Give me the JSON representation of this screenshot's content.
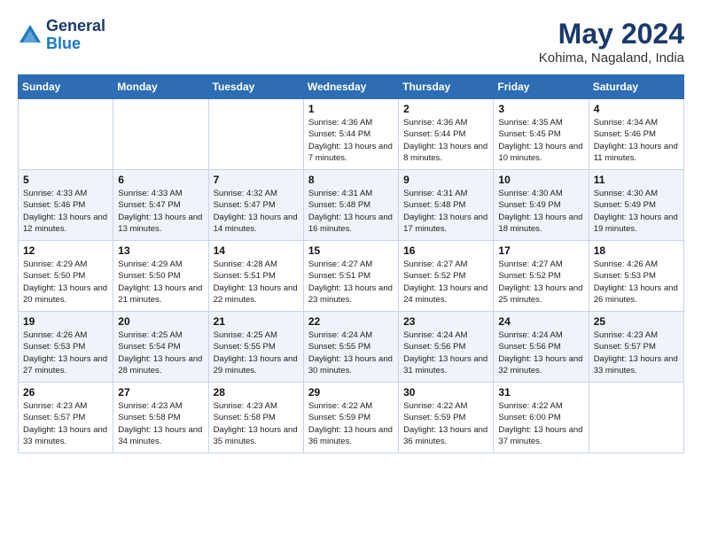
{
  "header": {
    "logo_line1": "General",
    "logo_line2": "Blue",
    "month_year": "May 2024",
    "location": "Kohima, Nagaland, India"
  },
  "weekdays": [
    "Sunday",
    "Monday",
    "Tuesday",
    "Wednesday",
    "Thursday",
    "Friday",
    "Saturday"
  ],
  "weeks": [
    [
      {
        "day": "",
        "info": ""
      },
      {
        "day": "",
        "info": ""
      },
      {
        "day": "",
        "info": ""
      },
      {
        "day": "1",
        "info": "Sunrise: 4:36 AM\nSunset: 5:44 PM\nDaylight: 13 hours\nand 7 minutes."
      },
      {
        "day": "2",
        "info": "Sunrise: 4:36 AM\nSunset: 5:44 PM\nDaylight: 13 hours\nand 8 minutes."
      },
      {
        "day": "3",
        "info": "Sunrise: 4:35 AM\nSunset: 5:45 PM\nDaylight: 13 hours\nand 10 minutes."
      },
      {
        "day": "4",
        "info": "Sunrise: 4:34 AM\nSunset: 5:46 PM\nDaylight: 13 hours\nand 11 minutes."
      }
    ],
    [
      {
        "day": "5",
        "info": "Sunrise: 4:33 AM\nSunset: 5:46 PM\nDaylight: 13 hours\nand 12 minutes."
      },
      {
        "day": "6",
        "info": "Sunrise: 4:33 AM\nSunset: 5:47 PM\nDaylight: 13 hours\nand 13 minutes."
      },
      {
        "day": "7",
        "info": "Sunrise: 4:32 AM\nSunset: 5:47 PM\nDaylight: 13 hours\nand 14 minutes."
      },
      {
        "day": "8",
        "info": "Sunrise: 4:31 AM\nSunset: 5:48 PM\nDaylight: 13 hours\nand 16 minutes."
      },
      {
        "day": "9",
        "info": "Sunrise: 4:31 AM\nSunset: 5:48 PM\nDaylight: 13 hours\nand 17 minutes."
      },
      {
        "day": "10",
        "info": "Sunrise: 4:30 AM\nSunset: 5:49 PM\nDaylight: 13 hours\nand 18 minutes."
      },
      {
        "day": "11",
        "info": "Sunrise: 4:30 AM\nSunset: 5:49 PM\nDaylight: 13 hours\nand 19 minutes."
      }
    ],
    [
      {
        "day": "12",
        "info": "Sunrise: 4:29 AM\nSunset: 5:50 PM\nDaylight: 13 hours\nand 20 minutes."
      },
      {
        "day": "13",
        "info": "Sunrise: 4:29 AM\nSunset: 5:50 PM\nDaylight: 13 hours\nand 21 minutes."
      },
      {
        "day": "14",
        "info": "Sunrise: 4:28 AM\nSunset: 5:51 PM\nDaylight: 13 hours\nand 22 minutes."
      },
      {
        "day": "15",
        "info": "Sunrise: 4:27 AM\nSunset: 5:51 PM\nDaylight: 13 hours\nand 23 minutes."
      },
      {
        "day": "16",
        "info": "Sunrise: 4:27 AM\nSunset: 5:52 PM\nDaylight: 13 hours\nand 24 minutes."
      },
      {
        "day": "17",
        "info": "Sunrise: 4:27 AM\nSunset: 5:52 PM\nDaylight: 13 hours\nand 25 minutes."
      },
      {
        "day": "18",
        "info": "Sunrise: 4:26 AM\nSunset: 5:53 PM\nDaylight: 13 hours\nand 26 minutes."
      }
    ],
    [
      {
        "day": "19",
        "info": "Sunrise: 4:26 AM\nSunset: 5:53 PM\nDaylight: 13 hours\nand 27 minutes."
      },
      {
        "day": "20",
        "info": "Sunrise: 4:25 AM\nSunset: 5:54 PM\nDaylight: 13 hours\nand 28 minutes."
      },
      {
        "day": "21",
        "info": "Sunrise: 4:25 AM\nSunset: 5:55 PM\nDaylight: 13 hours\nand 29 minutes."
      },
      {
        "day": "22",
        "info": "Sunrise: 4:24 AM\nSunset: 5:55 PM\nDaylight: 13 hours\nand 30 minutes."
      },
      {
        "day": "23",
        "info": "Sunrise: 4:24 AM\nSunset: 5:56 PM\nDaylight: 13 hours\nand 31 minutes."
      },
      {
        "day": "24",
        "info": "Sunrise: 4:24 AM\nSunset: 5:56 PM\nDaylight: 13 hours\nand 32 minutes."
      },
      {
        "day": "25",
        "info": "Sunrise: 4:23 AM\nSunset: 5:57 PM\nDaylight: 13 hours\nand 33 minutes."
      }
    ],
    [
      {
        "day": "26",
        "info": "Sunrise: 4:23 AM\nSunset: 5:57 PM\nDaylight: 13 hours\nand 33 minutes."
      },
      {
        "day": "27",
        "info": "Sunrise: 4:23 AM\nSunset: 5:58 PM\nDaylight: 13 hours\nand 34 minutes."
      },
      {
        "day": "28",
        "info": "Sunrise: 4:23 AM\nSunset: 5:58 PM\nDaylight: 13 hours\nand 35 minutes."
      },
      {
        "day": "29",
        "info": "Sunrise: 4:22 AM\nSunset: 5:59 PM\nDaylight: 13 hours\nand 36 minutes."
      },
      {
        "day": "30",
        "info": "Sunrise: 4:22 AM\nSunset: 5:59 PM\nDaylight: 13 hours\nand 36 minutes."
      },
      {
        "day": "31",
        "info": "Sunrise: 4:22 AM\nSunset: 6:00 PM\nDaylight: 13 hours\nand 37 minutes."
      },
      {
        "day": "",
        "info": ""
      }
    ]
  ]
}
